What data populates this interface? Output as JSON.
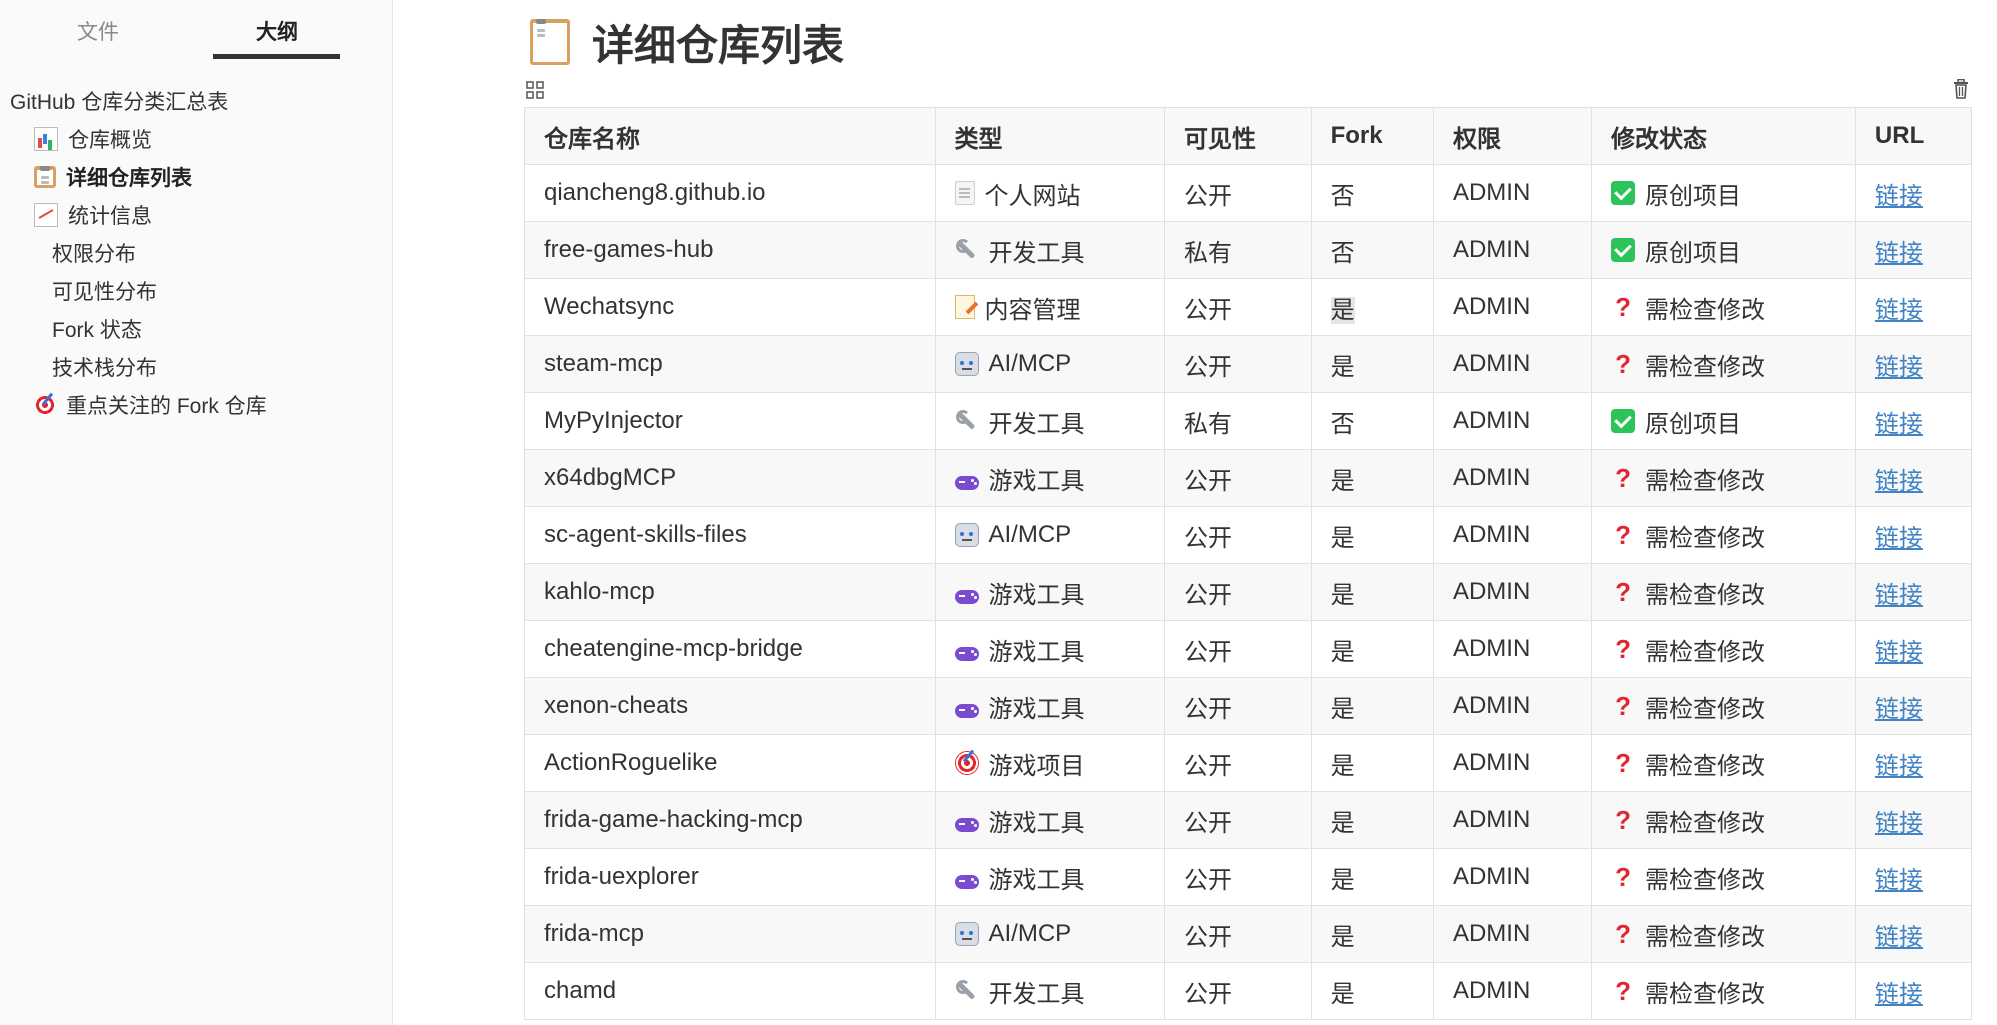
{
  "sidebar": {
    "tabs": [
      {
        "label": "文件"
      },
      {
        "label": "大纲"
      }
    ],
    "active_tab": "大纲",
    "outline": [
      {
        "label": "GitHub 仓库分类汇总表",
        "level": 1,
        "icon": ""
      },
      {
        "label": "仓库概览",
        "level": 2,
        "icon": "bar-chart-icon"
      },
      {
        "label": "详细仓库列表",
        "level": 2,
        "icon": "clipboard-icon",
        "active": true
      },
      {
        "label": "统计信息",
        "level": 2,
        "icon": "chart-increasing-icon"
      },
      {
        "label": "权限分布",
        "level": 3,
        "icon": ""
      },
      {
        "label": "可见性分布",
        "level": 3,
        "icon": ""
      },
      {
        "label": "Fork 状态",
        "level": 3,
        "icon": ""
      },
      {
        "label": "技术栈分布",
        "level": 3,
        "icon": ""
      },
      {
        "label": "重点关注的 Fork 仓库",
        "level": 2,
        "icon": "target-icon"
      }
    ]
  },
  "main": {
    "title": "详细仓库列表",
    "title_icon": "clipboard-icon",
    "table": {
      "headers": [
        "仓库名称",
        "类型",
        "可见性",
        "Fork",
        "权限",
        "修改状态",
        "URL"
      ],
      "rows": [
        {
          "name": "qiancheng8.github.io",
          "type": "个人网站",
          "type_icon": "document-icon",
          "visibility": "公开",
          "fork": "否",
          "perm": "ADMIN",
          "status": "原创项目",
          "status_icon": "check-icon",
          "url": "链接"
        },
        {
          "name": "free-games-hub",
          "type": "开发工具",
          "type_icon": "wrench-icon",
          "visibility": "私有",
          "fork": "否",
          "perm": "ADMIN",
          "status": "原创项目",
          "status_icon": "check-icon",
          "url": "链接"
        },
        {
          "name": "Wechatsync",
          "type": "内容管理",
          "type_icon": "memo-icon",
          "visibility": "公开",
          "fork": "是",
          "perm": "ADMIN",
          "status": "需检查修改",
          "status_icon": "question-icon",
          "url": "链接"
        },
        {
          "name": "steam-mcp",
          "type": "AI/MCP",
          "type_icon": "robot-icon",
          "visibility": "公开",
          "fork": "是",
          "perm": "ADMIN",
          "status": "需检查修改",
          "status_icon": "question-icon",
          "url": "链接"
        },
        {
          "name": "MyPyInjector",
          "type": "开发工具",
          "type_icon": "wrench-icon",
          "visibility": "私有",
          "fork": "否",
          "perm": "ADMIN",
          "status": "原创项目",
          "status_icon": "check-icon",
          "url": "链接"
        },
        {
          "name": "x64dbgMCP",
          "type": "游戏工具",
          "type_icon": "gamepad-icon",
          "visibility": "公开",
          "fork": "是",
          "perm": "ADMIN",
          "status": "需检查修改",
          "status_icon": "question-icon",
          "url": "链接"
        },
        {
          "name": "sc-agent-skills-files",
          "type": "AI/MCP",
          "type_icon": "robot-icon",
          "visibility": "公开",
          "fork": "是",
          "perm": "ADMIN",
          "status": "需检查修改",
          "status_icon": "question-icon",
          "url": "链接"
        },
        {
          "name": "kahlo-mcp",
          "type": "游戏工具",
          "type_icon": "gamepad-icon",
          "visibility": "公开",
          "fork": "是",
          "perm": "ADMIN",
          "status": "需检查修改",
          "status_icon": "question-icon",
          "url": "链接"
        },
        {
          "name": "cheatengine-mcp-bridge",
          "type": "游戏工具",
          "type_icon": "gamepad-icon",
          "visibility": "公开",
          "fork": "是",
          "perm": "ADMIN",
          "status": "需检查修改",
          "status_icon": "question-icon",
          "url": "链接"
        },
        {
          "name": "xenon-cheats",
          "type": "游戏工具",
          "type_icon": "gamepad-icon",
          "visibility": "公开",
          "fork": "是",
          "perm": "ADMIN",
          "status": "需检查修改",
          "status_icon": "question-icon",
          "url": "链接"
        },
        {
          "name": "ActionRoguelike",
          "type": "游戏项目",
          "type_icon": "target-icon",
          "visibility": "公开",
          "fork": "是",
          "perm": "ADMIN",
          "status": "需检查修改",
          "status_icon": "question-icon",
          "url": "链接"
        },
        {
          "name": "frida-game-hacking-mcp",
          "type": "游戏工具",
          "type_icon": "gamepad-icon",
          "visibility": "公开",
          "fork": "是",
          "perm": "ADMIN",
          "status": "需检查修改",
          "status_icon": "question-icon",
          "url": "链接"
        },
        {
          "name": "frida-uexplorer",
          "type": "游戏工具",
          "type_icon": "gamepad-icon",
          "visibility": "公开",
          "fork": "是",
          "perm": "ADMIN",
          "status": "需检查修改",
          "status_icon": "question-icon",
          "url": "链接"
        },
        {
          "name": "frida-mcp",
          "type": "AI/MCP",
          "type_icon": "robot-icon",
          "visibility": "公开",
          "fork": "是",
          "perm": "ADMIN",
          "status": "需检查修改",
          "status_icon": "question-icon",
          "url": "链接"
        },
        {
          "name": "chamd",
          "type": "开发工具",
          "type_icon": "wrench-icon",
          "visibility": "公开",
          "fork": "是",
          "perm": "ADMIN",
          "status": "需检查修改",
          "status_icon": "question-icon",
          "url": "链接"
        }
      ]
    }
  },
  "colors": {
    "link": "#4183c4",
    "check_green": "#2bc35a",
    "question_red": "#e0262e",
    "header_bg": "#f8f8f8",
    "sidebar_bg": "#fafafa"
  }
}
